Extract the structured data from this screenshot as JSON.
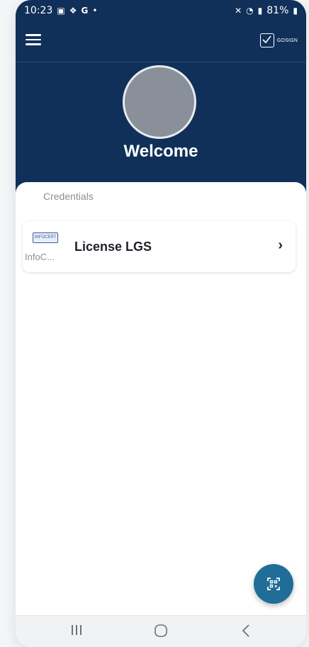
{
  "status_bar": {
    "time": "10:23",
    "left_icons": [
      "gallery-icon",
      "teams-icon",
      "google-icon",
      "dot-icon"
    ],
    "right_icons": [
      "mute-icon",
      "wifi-icon",
      "signal-icon"
    ],
    "battery": "81%"
  },
  "app_bar": {
    "menu_icon": "hamburger-menu-icon",
    "brand_label": "GOSIGN"
  },
  "header": {
    "welcome": "Welcome"
  },
  "credentials": {
    "section_title": "Credentials",
    "items": [
      {
        "logo_text": "INFOCERT",
        "issuer": "InfoC...",
        "title": "License LGS",
        "chevron": "›"
      }
    ]
  },
  "fab": {
    "icon": "qr-scan-icon"
  },
  "nav_bar": {
    "buttons": [
      "recent-apps",
      "home",
      "back"
    ]
  },
  "colors": {
    "primary": "#10305a",
    "fab": "#1f6d98",
    "muted_text": "#8c8f94"
  }
}
